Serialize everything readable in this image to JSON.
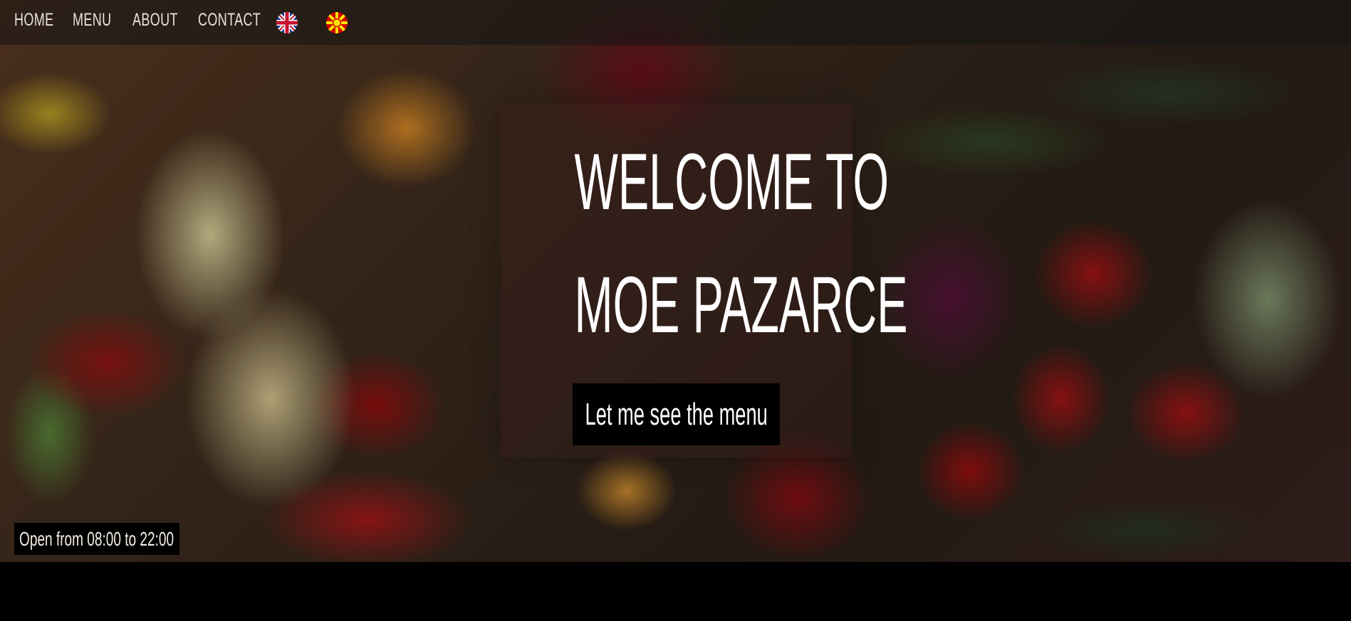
{
  "nav": {
    "items": [
      {
        "label": "Home"
      },
      {
        "label": "Menu"
      },
      {
        "label": "About"
      },
      {
        "label": "Contact"
      }
    ],
    "languages": [
      {
        "icon": "uk-flag-icon"
      },
      {
        "icon": "macedonia-flag-icon"
      }
    ]
  },
  "hero": {
    "title_line1": "Welcome to",
    "title_line2": "Moe Pazarce",
    "cta_label": "Let me see the menu",
    "hours": "Open from 08:00 to 22:00"
  },
  "colors": {
    "nav_bar": "#141414",
    "button_bg": "#000000",
    "text": "#ffffff"
  }
}
